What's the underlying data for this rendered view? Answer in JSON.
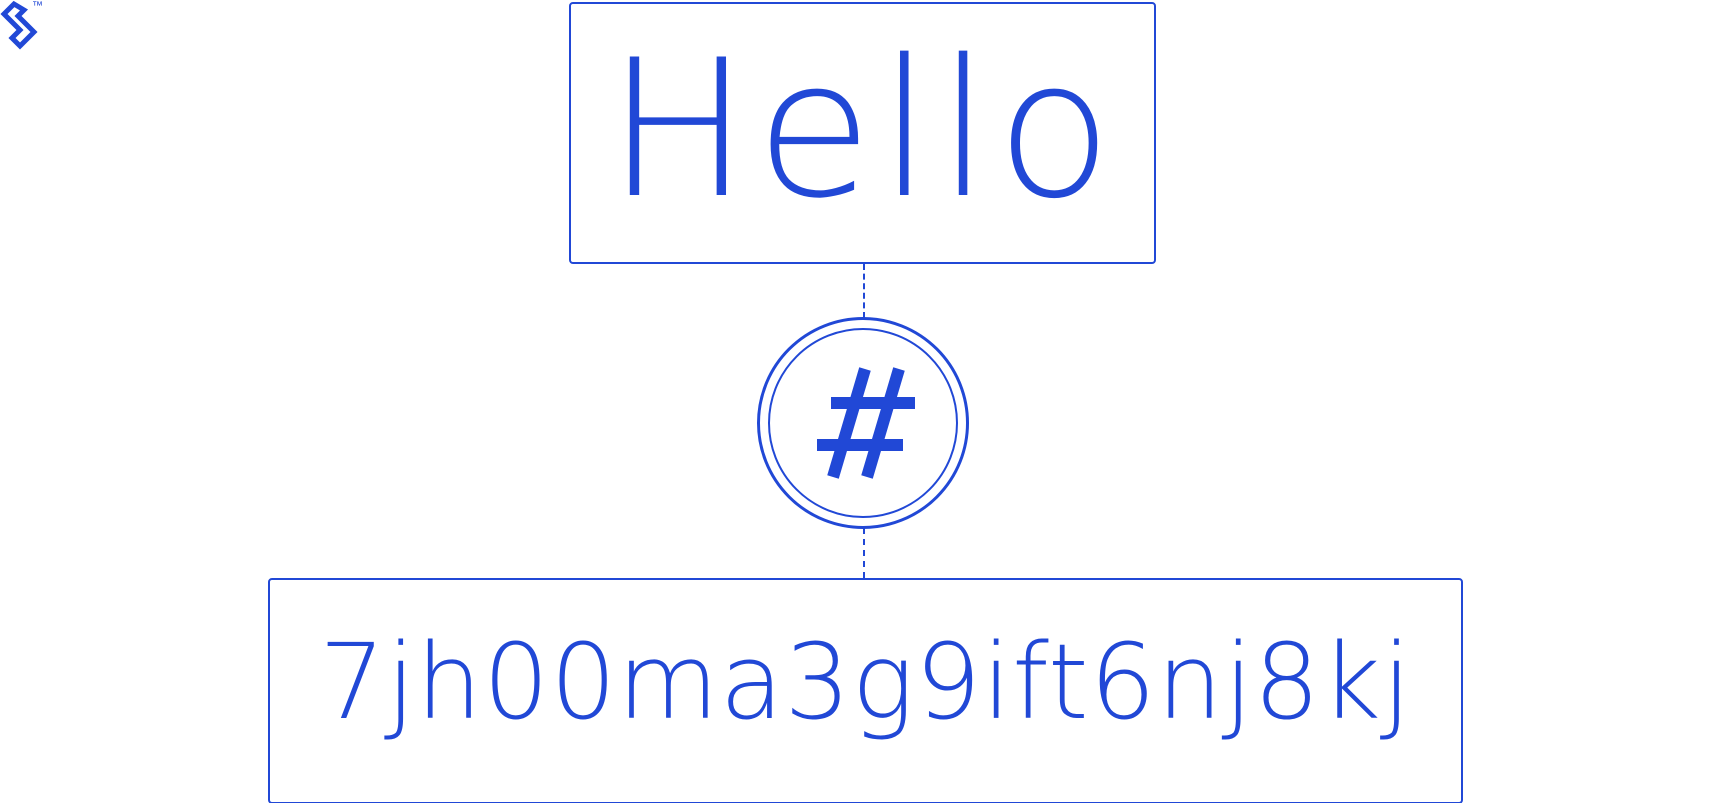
{
  "brand": {
    "trademark": "™",
    "logo_icon": "toptal-logo-icon"
  },
  "diagram": {
    "input_text": "Hello",
    "hash_icon": "hash-icon",
    "hash_symbol": "#",
    "output_text": "7jh00ma3g9ift6nj8kj"
  },
  "colors": {
    "accent": "#2148d6",
    "background": "#ffffff"
  }
}
